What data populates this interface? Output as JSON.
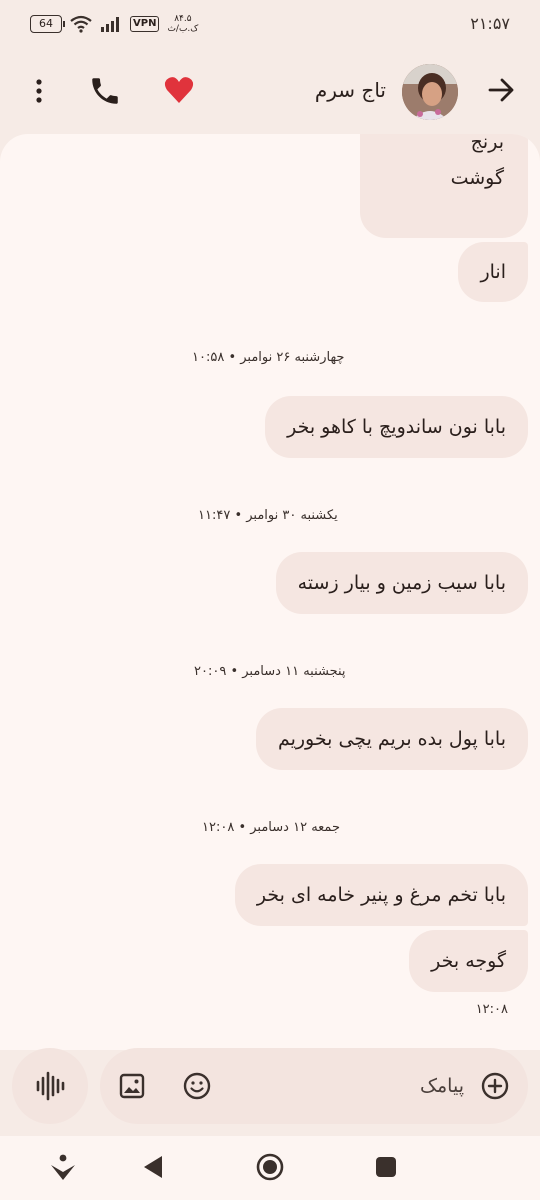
{
  "status": {
    "time": "۲۱:۵۷",
    "battery": "64",
    "vpn": "VPN",
    "speed_value": "۸۴.۵",
    "speed_unit": "ک.ب/ث"
  },
  "header": {
    "contact_name": "تاج سرم"
  },
  "messages": [
    {
      "lines": [
        "برنج",
        "گوشت"
      ]
    },
    {
      "text": "انار"
    },
    {
      "date": "چهارشنبه ۲۶ نوامبر • ۱۰:۵۸"
    },
    {
      "text": "بابا نون ساندویچ با کاهو بخر"
    },
    {
      "date": "یکشنبه ۳۰ نوامبر • ۱۱:۴۷"
    },
    {
      "text": "بابا سیب زمین و بیار زسته"
    },
    {
      "date": "پنجشنبه ۱۱ دسامبر • ۲۰:۰۹"
    },
    {
      "text": "بابا پول بده بریم یچی بخوریم"
    },
    {
      "date": "جمعه ۱۲ دسامبر • ۱۲:۰۸"
    },
    {
      "text": "بابا تخم مرغ و پنیر خامه ای بخر"
    },
    {
      "text": "گوجه بخر"
    },
    {
      "time": "۱۲:۰۸"
    }
  ],
  "compose": {
    "placeholder": "پیامک"
  }
}
